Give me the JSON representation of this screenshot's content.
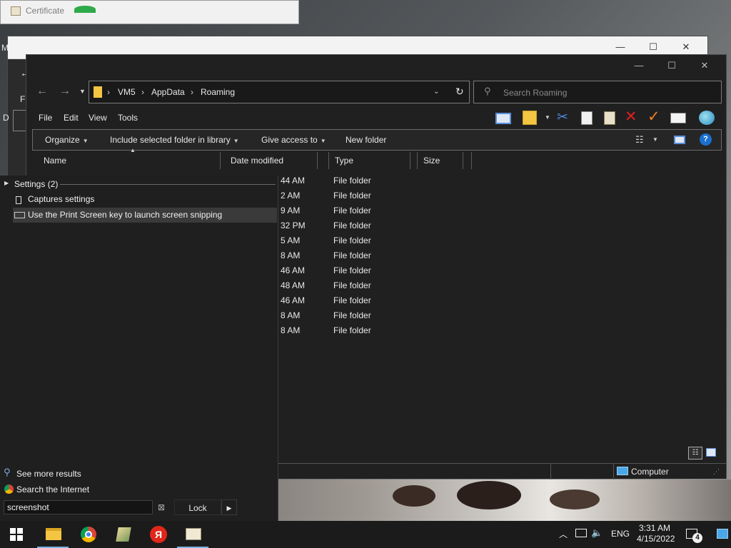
{
  "certificate": {
    "title": "Certificate",
    "close": "✕"
  },
  "back_window": {
    "partial_menu": "M",
    "partial_file": "Fi",
    "partial_label": "D"
  },
  "explorer": {
    "window_controls": {
      "minimize": "—",
      "maximize": "☐",
      "close": "✕"
    },
    "breadcrumb": [
      "VM5",
      "AppData",
      "Roaming"
    ],
    "search_placeholder": "Search Roaming",
    "menu": [
      "File",
      "Edit",
      "View",
      "Tools"
    ],
    "commands": {
      "organize": "Organize",
      "include": "Include selected folder in library",
      "give_access": "Give access to",
      "new_folder": "New folder"
    },
    "columns": {
      "name": "Name",
      "date": "Date modified",
      "type": "Type",
      "size": "Size"
    },
    "rows": [
      {
        "date": "44 AM",
        "type": "File folder"
      },
      {
        "date": "2 AM",
        "type": "File folder"
      },
      {
        "date": "9 AM",
        "type": "File folder"
      },
      {
        "date": "32 PM",
        "type": "File folder"
      },
      {
        "date": "5 AM",
        "type": "File folder"
      },
      {
        "date": "8 AM",
        "type": "File folder"
      },
      {
        "date": "46 AM",
        "type": "File folder"
      },
      {
        "date": "48 AM",
        "type": "File folder"
      },
      {
        "date": "46 AM",
        "type": "File folder"
      },
      {
        "date": "8 AM",
        "type": "File folder"
      },
      {
        "date": "8 AM",
        "type": "File folder"
      }
    ],
    "status": {
      "location": "Computer"
    }
  },
  "search_panel": {
    "group_header": "Settings (2)",
    "results": [
      {
        "label": "Captures settings",
        "selected": false
      },
      {
        "label": "Use the Print Screen key to launch screen snipping",
        "selected": true
      }
    ],
    "see_more": "See more results",
    "search_internet": "Search the Internet",
    "query": "screenshot",
    "lock_label": "Lock",
    "lock_arrow": "▶"
  },
  "taskbar": {
    "language": "ENG",
    "time": "3:31 AM",
    "date": "4/15/2022",
    "notification_count": "4",
    "yandex_letter": "Я"
  },
  "colors": {
    "accent_blue": "#1e90ff",
    "folder_yellow": "#f4c542",
    "dark_bg": "#202020"
  }
}
